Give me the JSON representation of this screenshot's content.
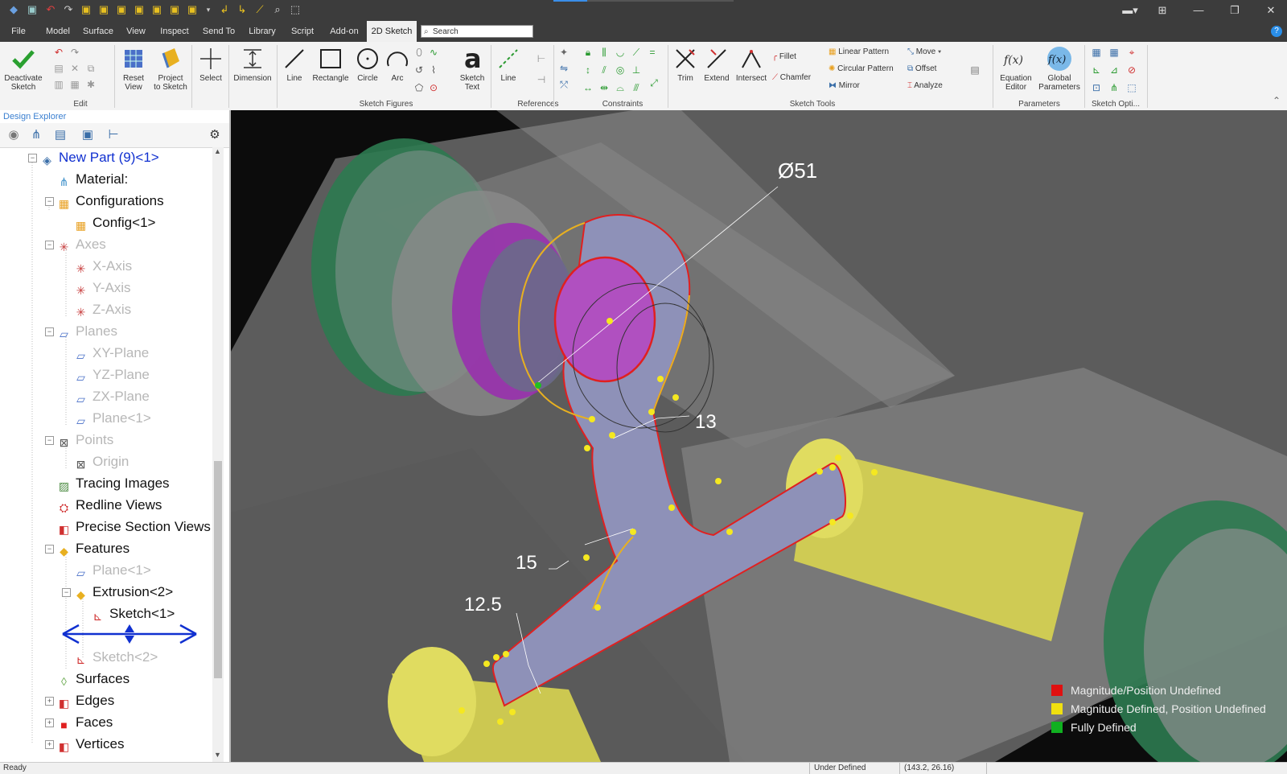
{
  "menu": [
    "File",
    "Model",
    "Surface",
    "View",
    "Inspect",
    "Send To",
    "Library",
    "Script",
    "Add-on",
    "2D Sketch"
  ],
  "search_placeholder": "Search",
  "ribbon": {
    "deactivate_sketch": "Deactivate\nSketch",
    "reset_view": "Reset\nView",
    "project_to_sketch": "Project\nto Sketch",
    "select": "Select",
    "dimension": "Dimension",
    "line": "Line",
    "rectangle": "Rectangle",
    "circle": "Circle",
    "arc": "Arc",
    "sketch_text": "Sketch\nText",
    "ref_line": "Line",
    "trim": "Trim",
    "extend": "Extend",
    "intersect": "Intersect",
    "fillet": "Fillet",
    "chamfer": "Chamfer",
    "linear_pattern": "Linear Pattern",
    "circular_pattern": "Circular Pattern",
    "mirror": "Mirror",
    "move": "Move",
    "offset": "Offset",
    "analyze": "Analyze",
    "equation_editor": "Equation\nEditor",
    "global_parameters": "Global\nParameters",
    "groups": {
      "edit": "Edit",
      "sketch_figures": "Sketch Figures",
      "references": "References",
      "constraints": "Constraints",
      "sketch_tools": "Sketch Tools",
      "parameters": "Parameters",
      "sketch_options": "Sketch Opti..."
    }
  },
  "explorer": {
    "title": "Design Explorer",
    "tree": [
      {
        "label": "New Part (9)<1>",
        "state": "selected",
        "icon": "part-icon"
      },
      {
        "label": "Material:",
        "state": "normal",
        "icon": "material-icon"
      },
      {
        "label": "Configurations",
        "state": "normal",
        "icon": "configurations-icon"
      },
      {
        "label": "Config<1>",
        "state": "normal",
        "icon": "config-icon"
      },
      {
        "label": "Axes",
        "state": "dim",
        "icon": "axes-icon"
      },
      {
        "label": "X-Axis",
        "state": "dim",
        "icon": "axis-icon"
      },
      {
        "label": "Y-Axis",
        "state": "dim",
        "icon": "axis-icon"
      },
      {
        "label": "Z-Axis",
        "state": "dim",
        "icon": "axis-icon"
      },
      {
        "label": "Planes",
        "state": "dim",
        "icon": "planes-icon"
      },
      {
        "label": "XY-Plane",
        "state": "dim",
        "icon": "plane-icon"
      },
      {
        "label": "YZ-Plane",
        "state": "dim",
        "icon": "plane-icon"
      },
      {
        "label": "ZX-Plane",
        "state": "dim",
        "icon": "plane-icon"
      },
      {
        "label": "Plane<1>",
        "state": "dim",
        "icon": "plane-icon"
      },
      {
        "label": "Points",
        "state": "dim",
        "icon": "points-icon"
      },
      {
        "label": "Origin",
        "state": "dim",
        "icon": "origin-icon"
      },
      {
        "label": "Tracing Images",
        "state": "normal",
        "icon": "tracing-images-icon"
      },
      {
        "label": "Redline Views",
        "state": "normal",
        "icon": "redline-views-icon"
      },
      {
        "label": "Precise Section Views",
        "state": "normal",
        "icon": "section-views-icon"
      },
      {
        "label": "Features",
        "state": "normal",
        "icon": "features-icon"
      },
      {
        "label": "Plane<1>",
        "state": "dim",
        "icon": "plane-icon"
      },
      {
        "label": "Extrusion<2>",
        "state": "normal",
        "icon": "extrusion-icon"
      },
      {
        "label": "Sketch<1>",
        "state": "normal",
        "icon": "sketch-icon"
      },
      {
        "label": "Sketch<2>",
        "state": "dim",
        "icon": "sketch-icon"
      },
      {
        "label": "Surfaces",
        "state": "normal",
        "icon": "surfaces-icon"
      },
      {
        "label": "Edges",
        "state": "normal",
        "icon": "edges-icon"
      },
      {
        "label": "Faces",
        "state": "normal",
        "icon": "faces-icon"
      },
      {
        "label": "Vertices",
        "state": "normal",
        "icon": "vertices-icon"
      }
    ]
  },
  "viewport": {
    "dimensions": [
      "Ø51",
      "13",
      "15",
      "12.5"
    ],
    "legend": [
      {
        "label": "Magnitude/Position Undefined",
        "color": "#e01010"
      },
      {
        "label": "Magnitude Defined, Position Undefined",
        "color": "#f0e010"
      },
      {
        "label": "Fully Defined",
        "color": "#10b020"
      }
    ]
  },
  "status": {
    "ready": "Ready",
    "state": "Under Defined",
    "coords": "(143.2, 26.16)"
  }
}
